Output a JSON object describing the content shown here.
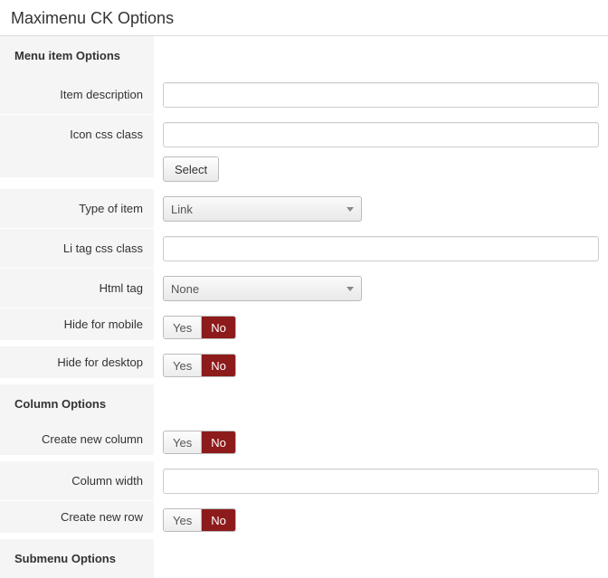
{
  "page": {
    "title": "Maximenu CK Options"
  },
  "sections": {
    "menu_item": "Menu item Options",
    "column": "Column Options",
    "submenu": "Submenu Options"
  },
  "fields": {
    "item_description": {
      "label": "Item description",
      "value": ""
    },
    "icon_css_class": {
      "label": "Icon css class",
      "value": "",
      "select_btn": "Select"
    },
    "type_of_item": {
      "label": "Type of item",
      "value": "Link"
    },
    "li_tag_css_class": {
      "label": "Li tag css class",
      "value": ""
    },
    "html_tag": {
      "label": "Html tag",
      "value": "None"
    },
    "hide_mobile": {
      "label": "Hide for mobile",
      "yes": "Yes",
      "no": "No",
      "value": "No"
    },
    "hide_desktop": {
      "label": "Hide for desktop",
      "yes": "Yes",
      "no": "No",
      "value": "No"
    },
    "create_column": {
      "label": "Create new column",
      "yes": "Yes",
      "no": "No",
      "value": "No"
    },
    "column_width": {
      "label": "Column width",
      "value": ""
    },
    "create_row": {
      "label": "Create new row",
      "yes": "Yes",
      "no": "No",
      "value": "No"
    }
  }
}
